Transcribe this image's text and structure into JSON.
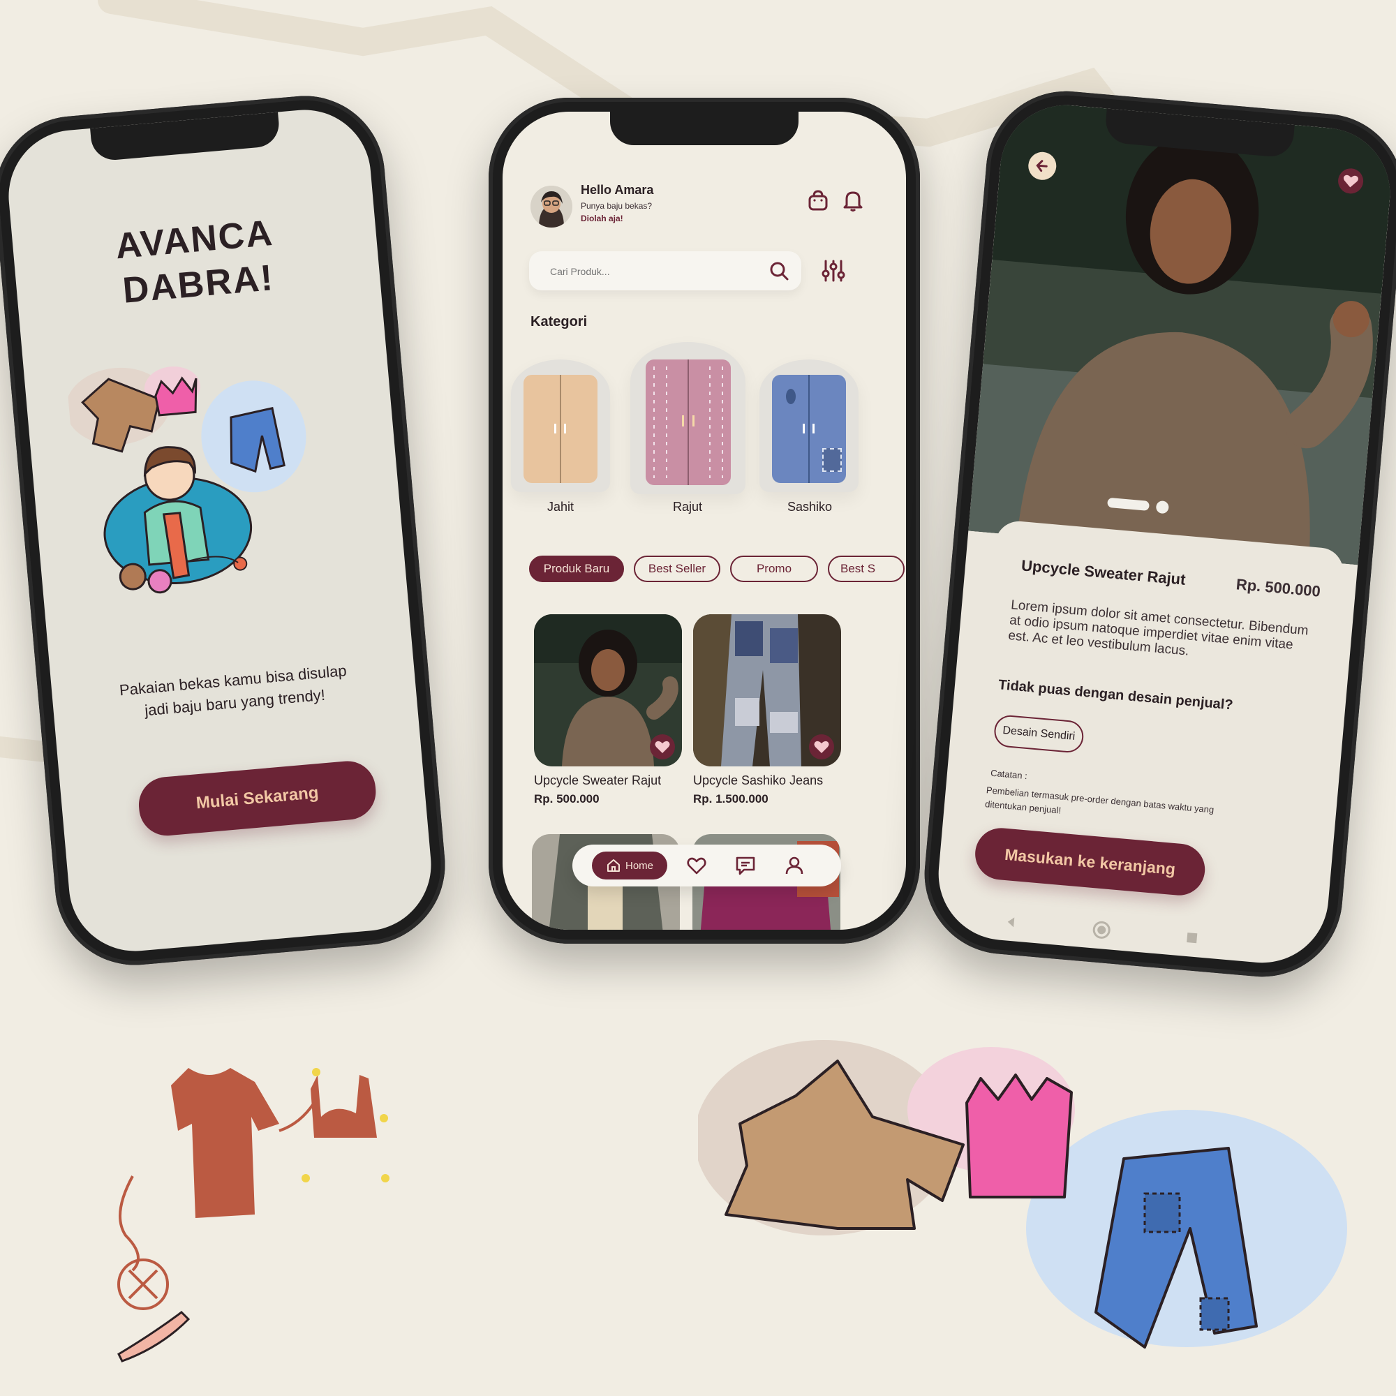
{
  "onboarding": {
    "title": "AVANCA\nDABRA!",
    "text": "Pakaian bekas kamu bisa disulap jadi baju baru yang trendy!",
    "cta": "Mulai Sekarang"
  },
  "home": {
    "greeting": "Hello Amara",
    "sub": "Punya baju bekas?",
    "sub_cta": "Diolah aja!",
    "search_placeholder": "Cari Produk...",
    "category_title": "Kategori",
    "categories": [
      {
        "label": "Jahit",
        "color": "#e8c49e"
      },
      {
        "label": "Rajut",
        "color": "#c98fa4"
      },
      {
        "label": "Sashiko",
        "color": "#6b86bf"
      }
    ],
    "tabs": [
      "Produk Baru",
      "Best Seller",
      "Promo",
      "Best S"
    ],
    "active_tab": "Produk Baru",
    "products": [
      {
        "name": "Upcycle Sweater Rajut",
        "price": "Rp. 500.000"
      },
      {
        "name": "Upcycle Sashiko Jeans",
        "price": "Rp. 1.500.000"
      }
    ],
    "nav": {
      "home_label": "Home",
      "icons": [
        "home-icon",
        "heart-icon",
        "chat-icon",
        "user-icon"
      ]
    }
  },
  "detail": {
    "name": "Upcycle Sweater Rajut",
    "price": "Rp. 500.000",
    "description": "Lorem ipsum dolor sit amet consectetur. Bibendum at odio ipsum natoque imperdiet vitae enim vitae est. Ac et leo vestibulum lacus.",
    "question": "Tidak puas dengan desain penjual?",
    "design_button": "Desain Sendiri",
    "note_label": "Catatan :",
    "note": "Pembelian termasuk pre-order dengan batas waktu yang ditentukan penjual!",
    "cta": "Masukan ke keranjang"
  },
  "colors": {
    "primary": "#6b2436",
    "background": "#f1ede3",
    "cta_text": "#f2c8a5"
  }
}
